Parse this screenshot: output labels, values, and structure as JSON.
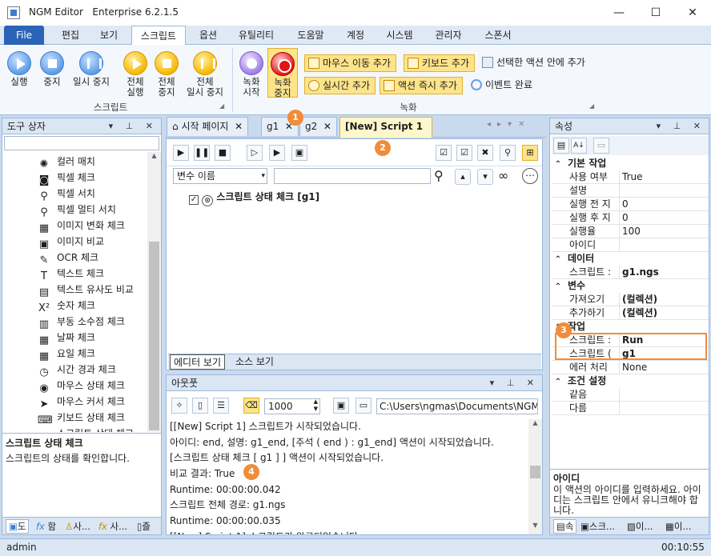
{
  "window": {
    "app_title": "NGM Editor",
    "edition": "Enterprise 6.2.1.5",
    "minimize": "—",
    "maximize": "☐",
    "close": "✕"
  },
  "menu": {
    "file": "File",
    "tabs": [
      "편집",
      "보기",
      "스크립트",
      "옵션",
      "유틸리티",
      "도움말",
      "계정",
      "시스템",
      "관리자",
      "스폰서"
    ],
    "active_index": 2
  },
  "ribbon": {
    "script_group": {
      "label": "스크립트",
      "buttons": [
        "실행",
        "중지",
        "일시 중지"
      ],
      "full_buttons": [
        [
          "전체",
          "실행"
        ],
        [
          "전체",
          "중지"
        ],
        [
          "전체",
          "일시 중지"
        ]
      ]
    },
    "record_group": {
      "label": "녹화",
      "record_start": [
        "녹화",
        "시작"
      ],
      "record_stop": [
        "녹화",
        "중지"
      ],
      "actions": [
        "마우스 이동 추가",
        "키보드 추가",
        "선택한 액션 안에 추가",
        "실시간 추가",
        "액션 즉시 추가",
        "이벤트 완료"
      ]
    }
  },
  "toolbox": {
    "title": "도구 상자",
    "items": [
      {
        "icon": "color-match-icon",
        "label": "컬러 매치"
      },
      {
        "icon": "camera-icon",
        "label": "픽셀 체크"
      },
      {
        "icon": "search-icon",
        "label": "픽셀 서치"
      },
      {
        "icon": "search-icon",
        "label": "픽셀 멀티 서치"
      },
      {
        "icon": "image-change-icon",
        "label": "이미지 변화 체크"
      },
      {
        "icon": "image-compare-icon",
        "label": "이미지 비교"
      },
      {
        "icon": "ocr-icon",
        "label": "OCR 체크"
      },
      {
        "icon": "text-icon",
        "label": "텍스트 체크"
      },
      {
        "icon": "text-similarity-icon",
        "label": "텍스트 유사도 비교"
      },
      {
        "icon": "number-icon",
        "label": "숫자 체크"
      },
      {
        "icon": "float-icon",
        "label": "부동 소수점 체크"
      },
      {
        "icon": "calendar-icon",
        "label": "날짜 체크"
      },
      {
        "icon": "calendar-week-icon",
        "label": "요일 체크"
      },
      {
        "icon": "clock-icon",
        "label": "시간 경과 체크"
      },
      {
        "icon": "mouse-icon",
        "label": "마우스 상태 체크"
      },
      {
        "icon": "cursor-icon",
        "label": "마우스 커서 체크"
      },
      {
        "icon": "keyboard-icon",
        "label": "키보드 상태 체크"
      },
      {
        "icon": "script-state-icon",
        "label": "스크립트 상태 체크"
      }
    ],
    "desc_title": "스크립트 상태 체크",
    "desc_text": "스크립트의 상태를 확인합니다.",
    "bottom_tabs": [
      "도",
      "함",
      "사...",
      "사...",
      "즐"
    ]
  },
  "document": {
    "tabs": [
      "시작 페이지",
      "g1",
      "g2",
      "[New] Script 1"
    ],
    "active_tab": "[New] Script 1",
    "variable_select": "변수 이름",
    "script_line": "스크립트 상태 체크 [g1]",
    "view_tabs": [
      "에디터 보기",
      "소스 보기"
    ],
    "badges": [
      "1",
      "2"
    ]
  },
  "output": {
    "title": "아웃풋",
    "count": "1000",
    "path": "C:\\Users\\ngmas\\Documents\\NGM6\\",
    "lines": [
      "[[New] Script 1] 스크립트가 시작되었습니다.",
      "아이디: end, 설명: g1_end, [주석 ( end ) : g1_end] 액션이 시작되었습니다.",
      "[스크립트 상태 체크 [ g1 ] ] 액션이 시작되었습니다.",
      "비교 결과: True",
      "Runtime: 00:00:00.042",
      "스크립트 전체 경로: g1.ngs",
      "Runtime: 00:00:00.035",
      "[[New] Script 1] 스크립트가 완료되었습니다."
    ],
    "badge": "4"
  },
  "properties": {
    "title": "속성",
    "rows": [
      {
        "type": "cat",
        "name": "기본 작업"
      },
      {
        "type": "prop",
        "name": "사용 여부",
        "value": "True"
      },
      {
        "type": "prop",
        "name": "설명",
        "value": ""
      },
      {
        "type": "prop",
        "name": "실행 전 지",
        "value": "0"
      },
      {
        "type": "prop",
        "name": "실행 후 지",
        "value": "0"
      },
      {
        "type": "prop",
        "name": "실행율",
        "value": "100"
      },
      {
        "type": "prop",
        "name": "아이디",
        "value": ""
      },
      {
        "type": "cat",
        "name": "데이터"
      },
      {
        "type": "prop",
        "name": "스크립트 :",
        "value": "g1.ngs",
        "bold": true
      },
      {
        "type": "cat",
        "name": "변수"
      },
      {
        "type": "prop",
        "name": "가져오기",
        "value": "(컬렉션)",
        "bold": true
      },
      {
        "type": "prop",
        "name": "추가하기",
        "value": "(컬렉션)",
        "bold": true
      },
      {
        "type": "cat",
        "name": "작업"
      },
      {
        "type": "prop",
        "name": "스크립트 :",
        "value": "Run",
        "bold": true
      },
      {
        "type": "prop",
        "name": "스크립트 (",
        "value": "g1",
        "bold": true
      },
      {
        "type": "prop",
        "name": "에러 처리",
        "value": "None"
      },
      {
        "type": "cat",
        "name": "조건 설정"
      },
      {
        "type": "prop",
        "name": "같음",
        "value": ""
      },
      {
        "type": "prop",
        "name": "다름",
        "value": ""
      }
    ],
    "desc_title": "아이디",
    "desc_text": "이 액션의 아이디를 입력하세요. 아이디는 스크립트 안에서 유니크해야 합니다.",
    "bottom_tabs": [
      "속",
      "스크...",
      "이...",
      "이..."
    ],
    "badge": "3"
  },
  "status": {
    "user": "admin",
    "time": "00:10:55"
  }
}
